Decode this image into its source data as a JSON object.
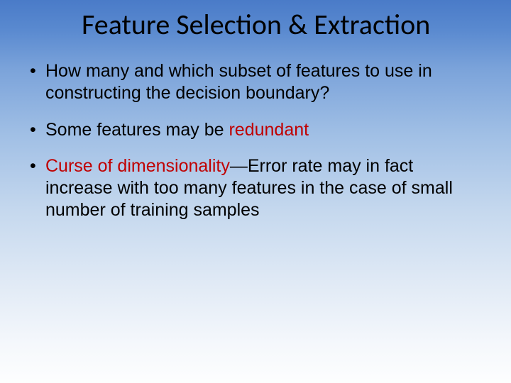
{
  "title": "Feature Selection & Extraction",
  "bullets": [
    {
      "pre": "How many and which subset of features to use in constructing the decision boundary?",
      "red": "",
      "post": ""
    },
    {
      "pre": "Some features may be ",
      "red": "redundant",
      "post": ""
    },
    {
      "pre": "",
      "red": "Curse of dimensionality",
      "post": "—Error rate may in fact increase with too many features in the case of small number of training samples"
    }
  ]
}
